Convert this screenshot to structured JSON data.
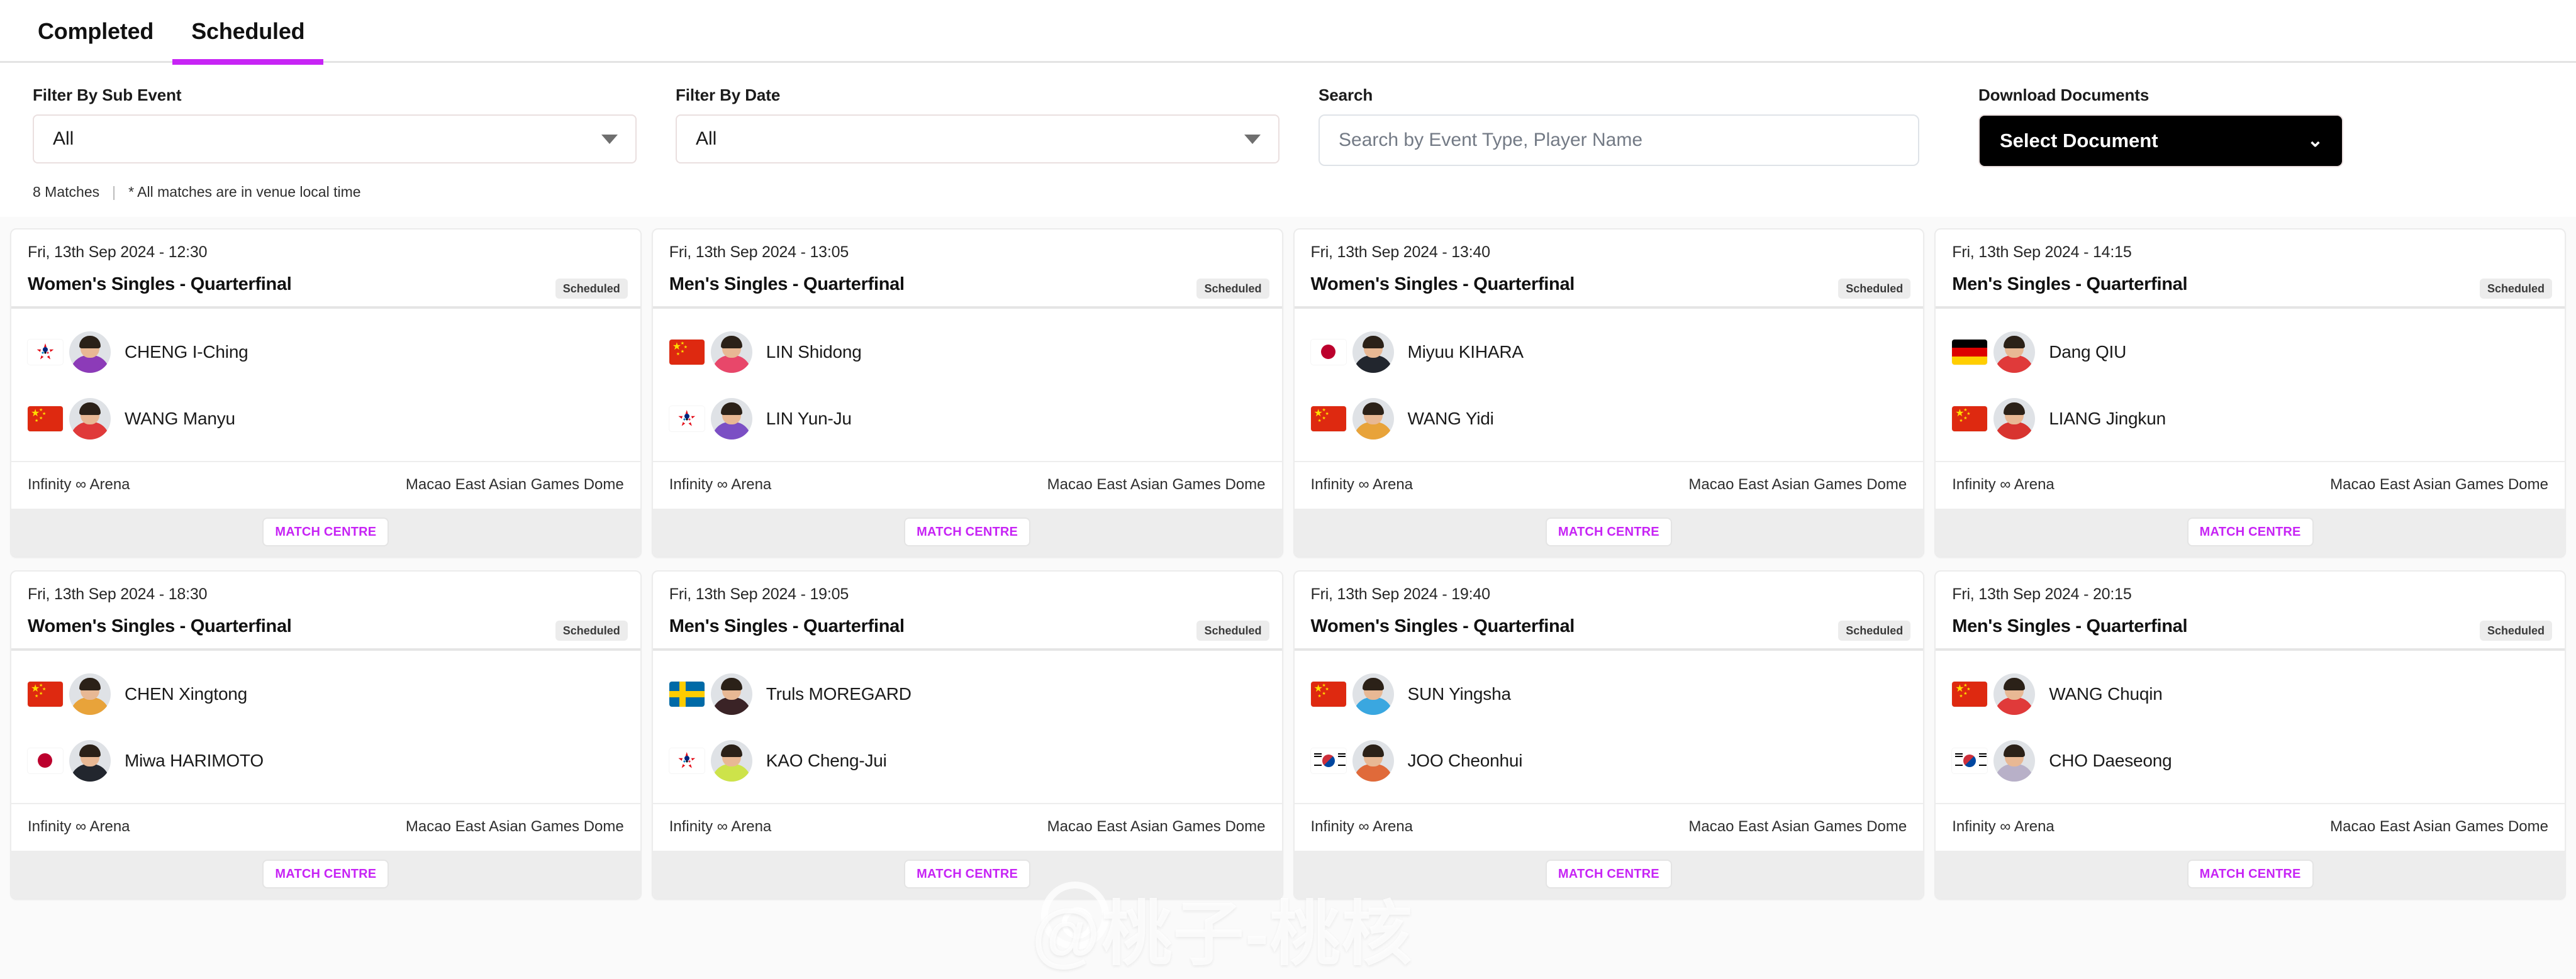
{
  "tabs": [
    {
      "label": "Completed",
      "active": false
    },
    {
      "label": "Scheduled",
      "active": true
    }
  ],
  "filters": {
    "sub_event": {
      "label": "Filter By Sub Event",
      "value": "All"
    },
    "date": {
      "label": "Filter By Date",
      "value": "All"
    },
    "search": {
      "label": "Search",
      "value": "",
      "placeholder": "Search by Event Type, Player Name"
    },
    "download": {
      "label": "Download Documents",
      "value": "Select Document"
    }
  },
  "meta": {
    "count": "8 Matches",
    "separator": "|",
    "note": "* All matches are in venue local time"
  },
  "venue_labels": {
    "arena": "Infinity ∞ Arena",
    "dome": "Macao East Asian Games Dome"
  },
  "match_centre_label": "MATCH CENTRE",
  "status_label": "Scheduled",
  "colors": {
    "accent": "#c724f5",
    "tab_underline": "#c724f5",
    "badge_bg": "#ececec",
    "card_bg": "#ffffff",
    "page_bg": "#fafafa",
    "doc_button_bg": "#000000"
  },
  "watermark": {
    "text": "@桃子-桃核"
  },
  "matches": [
    {
      "date": "Fri, 13th Sep 2024 - 12:30",
      "title": "Women's Singles - Quarterfinal",
      "status": "Scheduled",
      "venue_left": "Infinity ∞ Arena",
      "venue_right": "Macao East Asian Games Dome",
      "button": "MATCH CENTRE",
      "players": [
        {
          "name": "CHENG I-Ching",
          "flag": "TPE",
          "kit": "#8c3bb8"
        },
        {
          "name": "WANG Manyu",
          "flag": "CN",
          "kit": "#e03a3a"
        }
      ]
    },
    {
      "date": "Fri, 13th Sep 2024 - 13:05",
      "title": "Men's Singles - Quarterfinal",
      "status": "Scheduled",
      "venue_left": "Infinity ∞ Arena",
      "venue_right": "Macao East Asian Games Dome",
      "button": "MATCH CENTRE",
      "players": [
        {
          "name": "LIN Shidong",
          "flag": "CN",
          "kit": "#e8476a"
        },
        {
          "name": "LIN Yun-Ju",
          "flag": "TPE",
          "kit": "#7b4fc4"
        }
      ]
    },
    {
      "date": "Fri, 13th Sep 2024 - 13:40",
      "title": "Women's Singles - Quarterfinal",
      "status": "Scheduled",
      "venue_left": "Infinity ∞ Arena",
      "venue_right": "Macao East Asian Games Dome",
      "button": "MATCH CENTRE",
      "players": [
        {
          "name": "Miyuu KIHARA",
          "flag": "JP",
          "kit": "#22262e"
        },
        {
          "name": "WANG Yidi",
          "flag": "CN",
          "kit": "#e8a33a"
        }
      ]
    },
    {
      "date": "Fri, 13th Sep 2024 - 14:15",
      "title": "Men's Singles - Quarterfinal",
      "status": "Scheduled",
      "venue_left": "Infinity ∞ Arena",
      "venue_right": "Macao East Asian Games Dome",
      "button": "MATCH CENTRE",
      "players": [
        {
          "name": "Dang QIU",
          "flag": "DE",
          "kit": "#e03a3a"
        },
        {
          "name": "LIANG Jingkun",
          "flag": "CN",
          "kit": "#d8342f"
        }
      ]
    },
    {
      "date": "Fri, 13th Sep 2024 - 18:30",
      "title": "Women's Singles - Quarterfinal",
      "status": "Scheduled",
      "venue_left": "Infinity ∞ Arena",
      "venue_right": "Macao East Asian Games Dome",
      "button": "MATCH CENTRE",
      "players": [
        {
          "name": "CHEN Xingtong",
          "flag": "CN",
          "kit": "#e8a33a"
        },
        {
          "name": "Miwa HARIMOTO",
          "flag": "JP",
          "kit": "#22262e"
        }
      ]
    },
    {
      "date": "Fri, 13th Sep 2024 - 19:05",
      "title": "Men's Singles - Quarterfinal",
      "status": "Scheduled",
      "venue_left": "Infinity ∞ Arena",
      "venue_right": "Macao East Asian Games Dome",
      "button": "MATCH CENTRE",
      "players": [
        {
          "name": "Truls MOREGARD",
          "flag": "SE",
          "kit": "#3a2326"
        },
        {
          "name": "KAO Cheng-Jui",
          "flag": "TPE",
          "kit": "#cde34a"
        }
      ]
    },
    {
      "date": "Fri, 13th Sep 2024 - 19:40",
      "title": "Women's Singles - Quarterfinal",
      "status": "Scheduled",
      "venue_left": "Infinity ∞ Arena",
      "venue_right": "Macao East Asian Games Dome",
      "button": "MATCH CENTRE",
      "players": [
        {
          "name": "SUN Yingsha",
          "flag": "CN",
          "kit": "#3aa7e0"
        },
        {
          "name": "JOO Cheonhui",
          "flag": "KR",
          "kit": "#e06a3a"
        }
      ]
    },
    {
      "date": "Fri, 13th Sep 2024 - 20:15",
      "title": "Men's Singles - Quarterfinal",
      "status": "Scheduled",
      "venue_left": "Infinity ∞ Arena",
      "venue_right": "Macao East Asian Games Dome",
      "button": "MATCH CENTRE",
      "players": [
        {
          "name": "WANG Chuqin",
          "flag": "CN",
          "kit": "#e03a3a"
        },
        {
          "name": "CHO Daeseong",
          "flag": "KR",
          "kit": "#b8b0c8"
        }
      ]
    }
  ]
}
